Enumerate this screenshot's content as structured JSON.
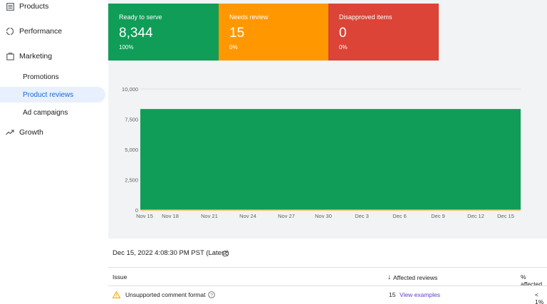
{
  "sidebar": {
    "items": [
      {
        "label": "Products",
        "icon": "products-icon"
      },
      {
        "label": "Performance",
        "icon": "performance-icon"
      },
      {
        "label": "Marketing",
        "icon": "marketing-icon"
      }
    ],
    "sub_items": [
      {
        "label": "Promotions",
        "active": false
      },
      {
        "label": "Product reviews",
        "active": true
      },
      {
        "label": "Ad campaigns",
        "active": false
      }
    ],
    "growth": {
      "label": "Growth",
      "icon": "trending-up-icon"
    }
  },
  "cards": [
    {
      "label": "Ready to serve",
      "value": "8,344",
      "pct": "100%",
      "color": "#0f9d58"
    },
    {
      "label": "Needs review",
      "value": "15",
      "pct": "0%",
      "color": "#ff9800"
    },
    {
      "label": "Disapproved items",
      "value": "0",
      "pct": "0%",
      "color": "#db4437"
    }
  ],
  "chart_data": {
    "type": "area",
    "y_ticks": [
      "10,000",
      "7,500",
      "5,000",
      "2,500",
      "0"
    ],
    "ylim": [
      0,
      10000
    ],
    "x_ticks": [
      "Nov 15",
      "Nov 18",
      "Nov 21",
      "Nov 24",
      "Nov 27",
      "Nov 30",
      "Dec 3",
      "Dec 6",
      "Dec 9",
      "Dec 12",
      "Dec 15"
    ],
    "series": [
      {
        "color": "#0f9d58",
        "values": [
          8344,
          8344,
          8344,
          8344,
          8344,
          8344,
          8344,
          8344,
          8344,
          8344,
          8344
        ]
      },
      {
        "color": "#ff9800",
        "values": [
          15,
          15,
          15,
          15,
          15,
          15,
          15,
          15,
          15,
          15,
          15
        ]
      }
    ],
    "grid": true
  },
  "status": {
    "timestamp": "Dec 15, 2022 4:08:30 PM PST (Latest)"
  },
  "table": {
    "headers": {
      "issue": "Issue",
      "affected": "Affected reviews",
      "pct": "% affected"
    },
    "rows": [
      {
        "issue": "Unsupported comment format",
        "affected": "15",
        "action": "View examples",
        "pct": "< 1%"
      }
    ]
  }
}
